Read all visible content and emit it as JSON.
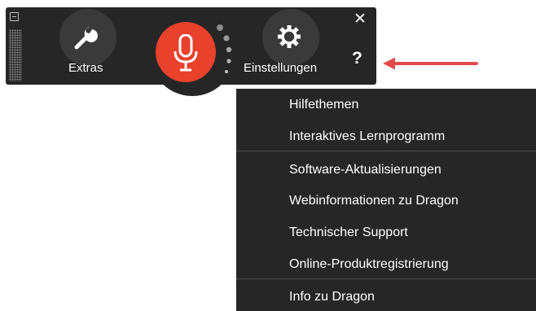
{
  "toolbar": {
    "extras_label": "Extras",
    "settings_label": "Einstellungen",
    "close_symbol": "✕",
    "help_symbol": "?",
    "microphone_state": "off",
    "accent_color": "#e8412c"
  },
  "help_menu": {
    "items": [
      {
        "label": "Hilfethemen"
      },
      {
        "label": "Interaktives Lernprogramm"
      },
      {
        "label": "Software-Aktualisierungen"
      },
      {
        "label": "Webinformationen zu Dragon"
      },
      {
        "label": "Technischer Support"
      },
      {
        "label": "Online-Produktregistrierung"
      },
      {
        "label": "Info zu Dragon"
      }
    ]
  },
  "annotation": {
    "arrow_color": "#e24a4a"
  },
  "icons": [
    "minimize-icon",
    "wrench-icon",
    "microphone-icon",
    "gear-icon",
    "close-icon",
    "help-icon"
  ]
}
